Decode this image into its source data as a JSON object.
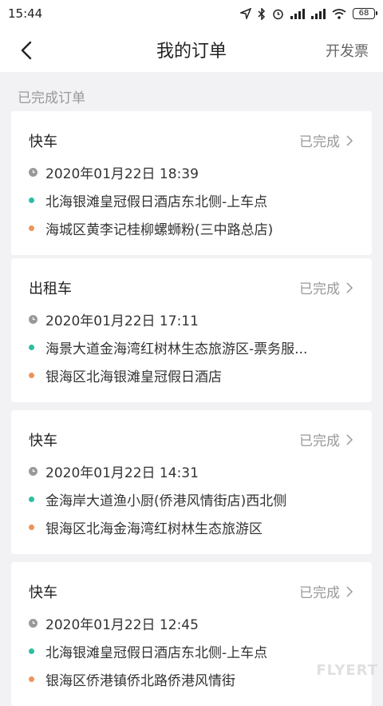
{
  "status_bar": {
    "time": "15:44",
    "battery": "68"
  },
  "nav": {
    "title": "我的订单",
    "action": "开发票"
  },
  "section_label": "已完成订单",
  "colors": {
    "from_dot": "#2bbfa4",
    "to_dot": "#f0935a",
    "clock": "#999999"
  },
  "orders": [
    {
      "type": "快车",
      "status": "已完成",
      "time": "2020年01月22日 18:39",
      "from": "北海银滩皇冠假日酒店东北侧-上车点",
      "to": "海城区黄李记桂柳螺蛳粉(三中路总店)"
    },
    {
      "type": "出租车",
      "status": "已完成",
      "time": "2020年01月22日 17:11",
      "from": "海景大道金海湾红树林生态旅游区-票务服...",
      "to": "银海区北海银滩皇冠假日酒店"
    },
    {
      "type": "快车",
      "status": "已完成",
      "time": "2020年01月22日 14:31",
      "from": "金海岸大道渔小厨(侨港风情街店)西北侧",
      "to": "银海区北海金海湾红树林生态旅游区"
    },
    {
      "type": "快车",
      "status": "已完成",
      "time": "2020年01月22日 12:45",
      "from": "北海银滩皇冠假日酒店东北侧-上车点",
      "to": "银海区侨港镇侨北路侨港风情街"
    }
  ],
  "watermark": "FLYERT"
}
